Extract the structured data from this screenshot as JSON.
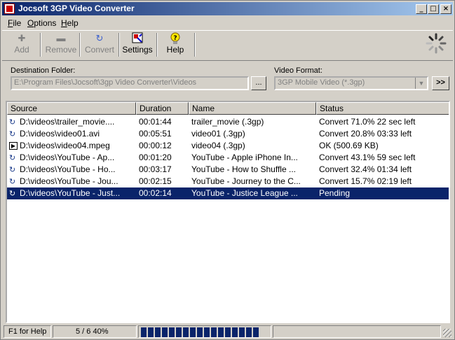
{
  "window": {
    "title": "Jocsoft 3GP Video Converter"
  },
  "menu": [
    {
      "label": "File",
      "accel": "F",
      "rest": "ile"
    },
    {
      "label": "Options",
      "accel": "O",
      "rest": "ptions"
    },
    {
      "label": "Help",
      "accel": "H",
      "rest": "elp"
    }
  ],
  "toolbar": {
    "add": "Add",
    "remove": "Remove",
    "convert": "Convert",
    "settings": "Settings",
    "help": "Help",
    "icons": {
      "add": "plus-icon",
      "remove": "minus-icon",
      "convert": "convert-arrow-icon",
      "settings": "settings-icon",
      "help": "help-bulb-icon"
    }
  },
  "destination": {
    "label": "Destination Folder:",
    "value": "E:\\Program Files\\Jocsoft\\3gp Video Converter\\Videos",
    "browse": "..."
  },
  "format": {
    "label": "Video Format:",
    "value": "3GP Mobile Video (*.3gp)",
    "next": ">>"
  },
  "columns": [
    "Source",
    "Duration",
    "Name",
    "Status"
  ],
  "rows": [
    {
      "icon": "convert-arrow-icon",
      "source": "D:\\videos\\trailer_movie....",
      "duration": "00:01:44",
      "name": "trailer_movie (.3gp)",
      "status": "Convert 71.0%  22 sec left"
    },
    {
      "icon": "convert-arrow-icon",
      "source": "D:\\videos\\video01.avi",
      "duration": "00:05:51",
      "name": "video01 (.3gp)",
      "status": "Convert 20.8%  03:33 left"
    },
    {
      "icon": "play-box-icon",
      "source": "D:\\videos\\video04.mpeg",
      "duration": "00:00:12",
      "name": "video04 (.3gp)",
      "status": "OK    (500.69 KB)"
    },
    {
      "icon": "convert-arrow-icon",
      "source": "D:\\videos\\YouTube - Ap...",
      "duration": "00:01:20",
      "name": "YouTube - Apple iPhone In...",
      "status": "Convert 43.1%  59 sec left"
    },
    {
      "icon": "convert-arrow-icon",
      "source": "D:\\videos\\YouTube - Ho...",
      "duration": "00:03:17",
      "name": "YouTube - How to Shuffle ...",
      "status": "Convert 32.4%  01:34 left"
    },
    {
      "icon": "convert-arrow-icon",
      "source": "D:\\videos\\YouTube - Jou...",
      "duration": "00:02:15",
      "name": "YouTube - Journey to the C...",
      "status": "Convert 15.7%  02:19 left"
    },
    {
      "icon": "convert-arrow-icon",
      "source": "D:\\videos\\YouTube - Just...",
      "duration": "00:02:14",
      "name": "YouTube - Justice League ...",
      "status": "Pending",
      "selected": true
    }
  ],
  "status": {
    "help": "F1 for Help",
    "progress_text": "5 / 6  40%",
    "progress": 0.4
  },
  "colors": {
    "selection": "#0a246a",
    "face": "#d4d0c8"
  }
}
